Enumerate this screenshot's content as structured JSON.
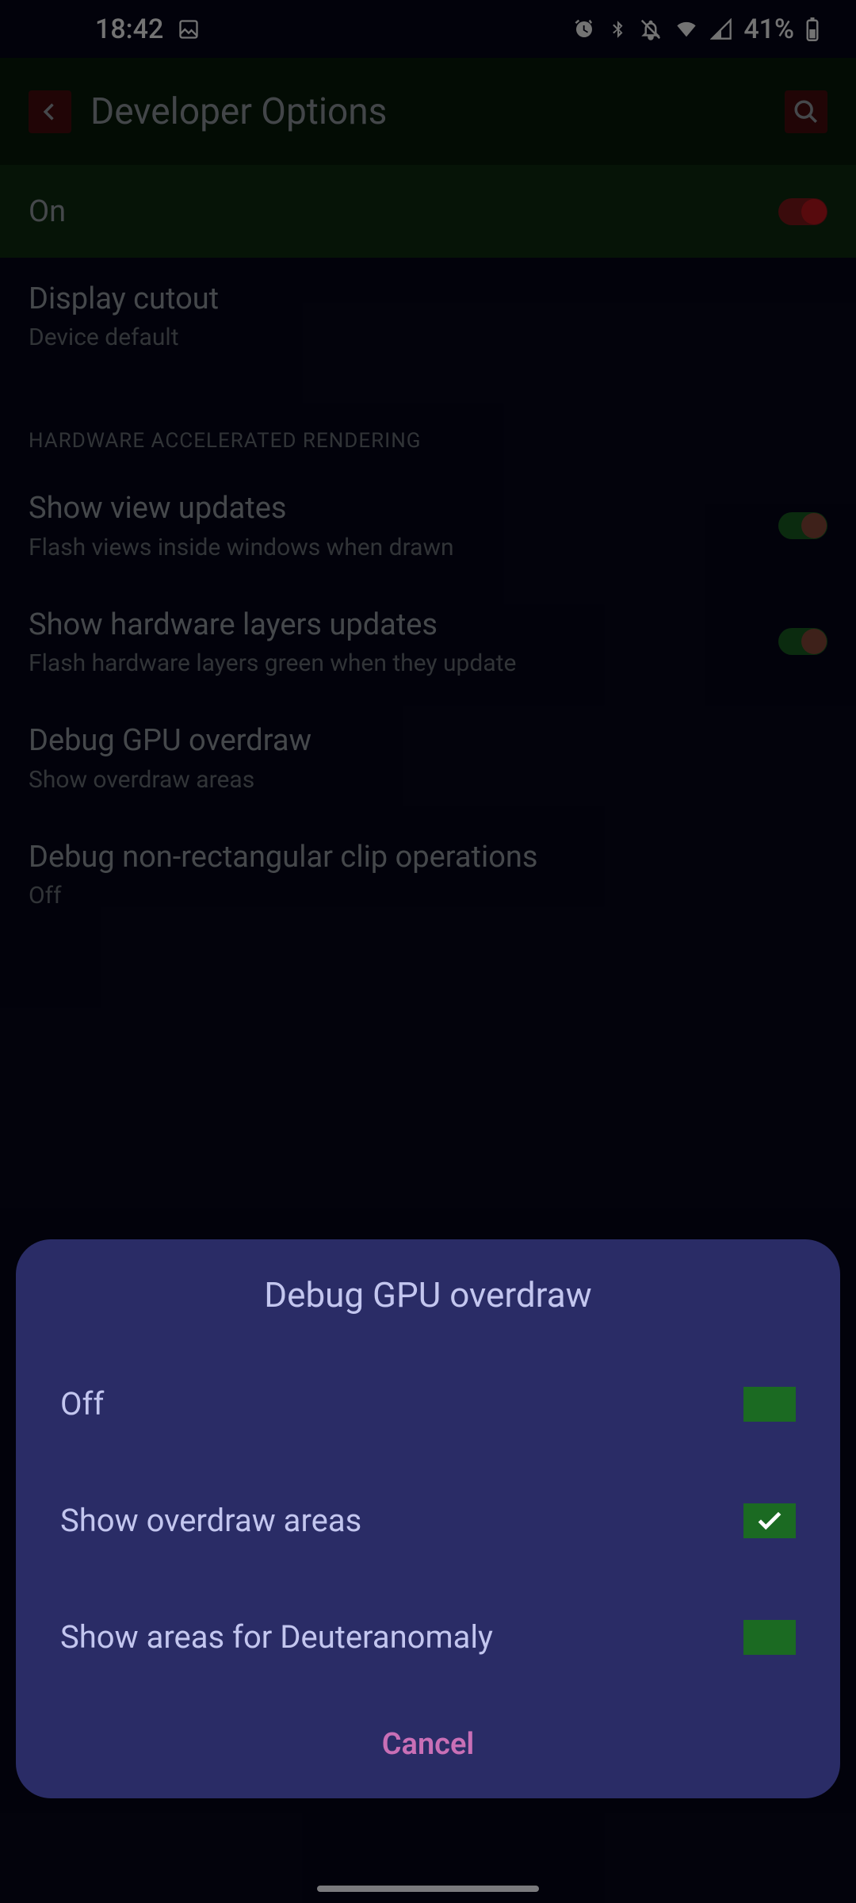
{
  "status": {
    "time": "18:42",
    "battery_pct": "41%"
  },
  "header": {
    "title": "Developer Options"
  },
  "master": {
    "label": "On"
  },
  "items": {
    "display_cutout": {
      "title": "Display cutout",
      "sub": "Device default"
    },
    "section1": "HARDWARE ACCELERATED RENDERING",
    "show_view_updates": {
      "title": "Show view updates",
      "sub": "Flash views inside windows when drawn"
    },
    "show_hw_layers": {
      "title": "Show hardware layers updates",
      "sub": "Flash hardware layers green when they update"
    },
    "debug_overdraw": {
      "title": "Debug GPU overdraw",
      "sub": "Show overdraw areas"
    },
    "debug_clip": {
      "title": "Debug non-rectangular clip operations",
      "sub": "Off"
    }
  },
  "dialog": {
    "title": "Debug GPU overdraw",
    "options": [
      "Off",
      "Show overdraw areas",
      "Show areas for Deuteranomaly"
    ],
    "selected_index": 1,
    "cancel": "Cancel"
  }
}
